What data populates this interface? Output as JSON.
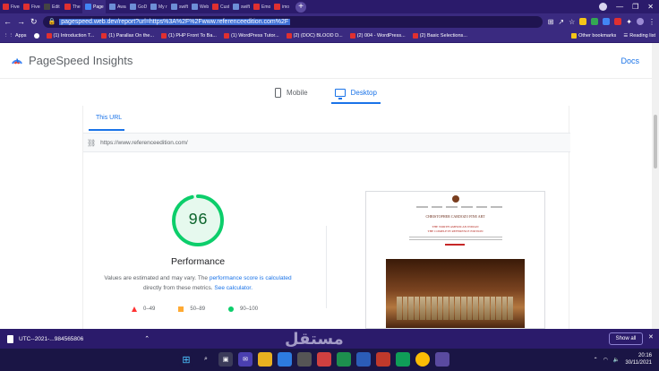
{
  "tabs": [
    {
      "label": "Fiverr",
      "color": "#e03030"
    },
    {
      "label": "Fiverr",
      "color": "#e03030"
    },
    {
      "label": "Edit",
      "color": "#444444"
    },
    {
      "label": "The",
      "color": "#e03030"
    },
    {
      "label": "Page",
      "color": "#4285f4",
      "active": true
    },
    {
      "label": "Awar",
      "color": "#6d8ed6"
    },
    {
      "label": "GoD",
      "color": "#6d8ed6"
    },
    {
      "label": "My r",
      "color": "#6d8ed6"
    },
    {
      "label": "swift",
      "color": "#6d8ed6"
    },
    {
      "label": "Web",
      "color": "#6d8ed6"
    },
    {
      "label": "Cust",
      "color": "#e03030"
    },
    {
      "label": "swift",
      "color": "#6d8ed6"
    },
    {
      "label": "Emo",
      "color": "#e03030"
    },
    {
      "label": "imo",
      "color": "#e03030"
    }
  ],
  "toolbar": {
    "url": "pagespeed.web.dev/report?url=https%3A%2F%2Fwww.referenceedition.com%2F"
  },
  "bookmarks": {
    "apps": "Apps",
    "items": [
      "(1) Introduction T...",
      "(1) Parallax On the...",
      "(1) PHP Front To Ba...",
      "(1) WordPress Tutor...",
      "(2) (DOC) BLOOD D...",
      "(2) 004 - WordPress...",
      "(2) Basic Selections..."
    ],
    "other": "Other bookmarks",
    "reading": "Reading list"
  },
  "header": {
    "brand": "PageSpeed Insights",
    "docs": "Docs"
  },
  "device_tabs": {
    "mobile": "Mobile",
    "desktop": "Desktop"
  },
  "report": {
    "this_url_tab": "This URL",
    "tested_url": "https://www.referenceedition.com/",
    "score": "96",
    "score_fraction": 0.96,
    "category": "Performance",
    "disclaimer_pre": "Values are estimated and may vary. The ",
    "disclaimer_link1": "performance score is calculated",
    "disclaimer_mid": " directly from these metrics. ",
    "disclaimer_link2": "See calculator.",
    "legend": {
      "poor": "0–49",
      "average": "50–89",
      "good": "90–100"
    },
    "colors": {
      "good": "#0cce6b",
      "average": "#ffaa33",
      "poor": "#ff3333"
    }
  },
  "preview": {
    "heading": "CHRISTOPHER CARDOZO FINE ART",
    "subheading_line1": "THE NORTH AMERICAN INDIAN",
    "subheading_line2": "THE COMPLETE REFERENCE EDITION"
  },
  "downloads": {
    "file": "UTC--2021-...984565806",
    "show_all": "Show all"
  },
  "taskbar": {
    "time": "20:16",
    "date": "30/11/2021"
  },
  "watermark": "مستقل"
}
